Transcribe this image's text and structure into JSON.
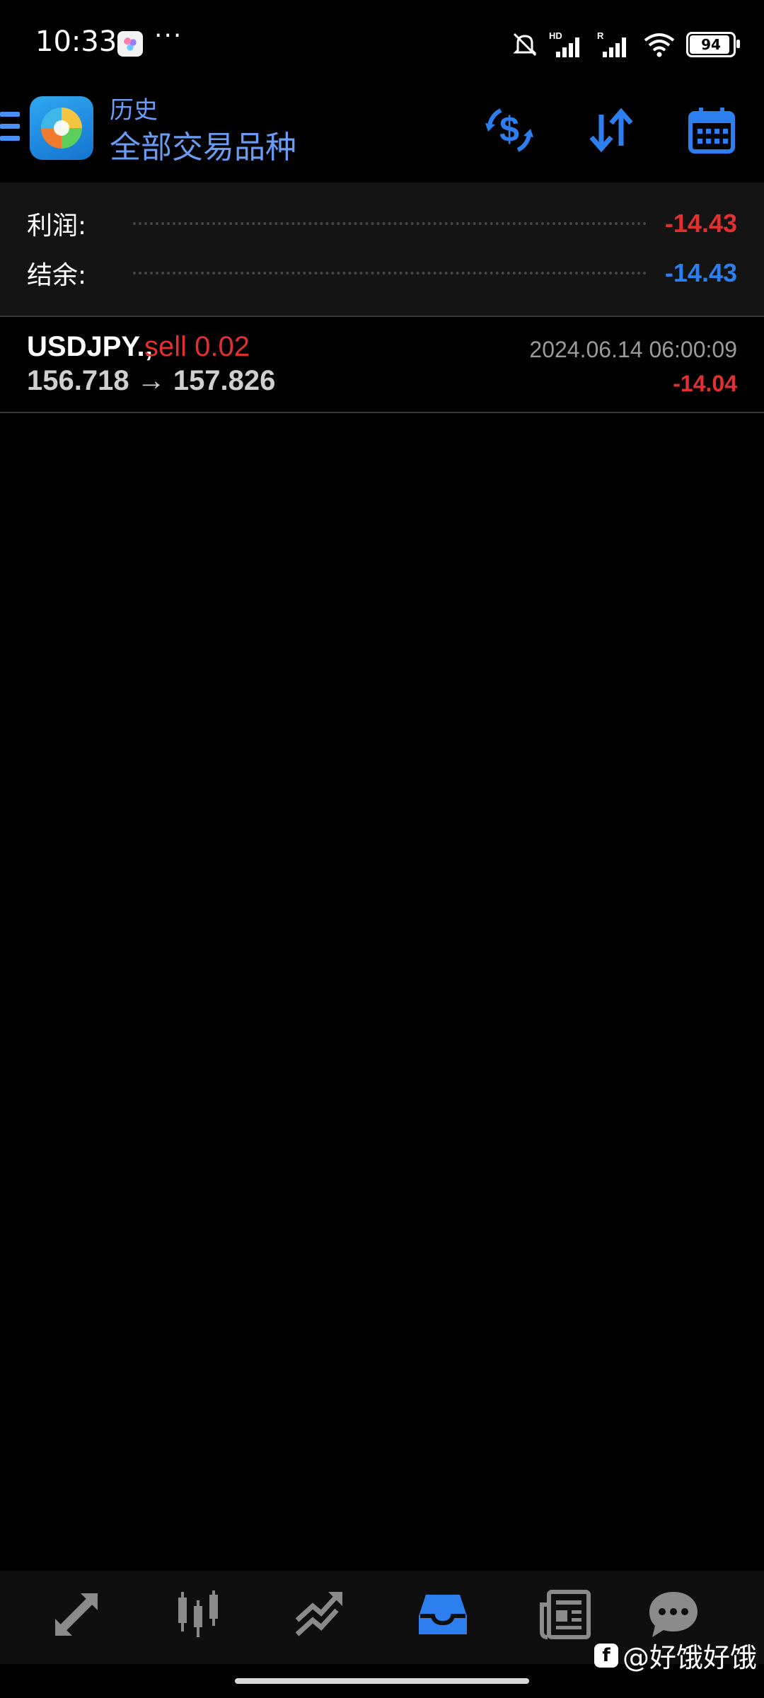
{
  "status_bar": {
    "time": "10:33",
    "more": "···",
    "hd_label": "HD",
    "r_label": "R",
    "battery": "94"
  },
  "header": {
    "subtitle": "历史",
    "title": "全部交易品种",
    "icons": [
      "menu-icon",
      "currency-exchange-icon",
      "sort-icon",
      "calendar-icon"
    ]
  },
  "summary": {
    "profit_label": "利润:",
    "profit_value": "-14.43",
    "balance_label": "结余:",
    "balance_value": "-14.43"
  },
  "trades": [
    {
      "symbol": "USDJPY.,",
      "side": "sell 0.02",
      "prices": "156.718 → 157.826",
      "date": "2024.06.14 06:00:09",
      "profit": "-14.04"
    }
  ],
  "bottom_nav": [
    {
      "icon": "quotes-icon",
      "active": false
    },
    {
      "icon": "chart-icon",
      "active": false
    },
    {
      "icon": "trade-icon",
      "active": false
    },
    {
      "icon": "history-icon",
      "active": true
    },
    {
      "icon": "news-icon",
      "active": false
    },
    {
      "icon": "chat-icon",
      "active": false
    }
  ],
  "watermark": {
    "badge": "f",
    "text": "@好饿好饿"
  },
  "colors": {
    "accent": "#2d7ff0",
    "loss": "#e0302f",
    "background": "#000000"
  }
}
